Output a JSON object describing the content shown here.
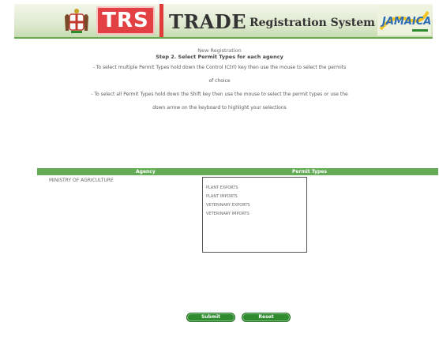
{
  "header": {
    "trs_logo_text": "TRS",
    "title_main": "TRADE",
    "title_sub": "Registration System",
    "jamaica_logo_text": "JAMAICA",
    "colors": {
      "brand_red": "#e34044",
      "brand_green": "#63ab55"
    }
  },
  "instructions": {
    "heading": "New Registration",
    "step": "Step 2. Select Permit Types for each agency",
    "line1": "- To select multiple Permit Types hold down the Control (Ctrl) key then use the mouse to select the permits",
    "line1_cont": "of choice",
    "line2": "- To select all Permit Types hold down the Shift key then use the mouse to select the permit types or use the",
    "line2_cont": "down arrow on the keyboard to highlight your selections"
  },
  "table": {
    "columns": {
      "agency": "Agency",
      "permit_types": "Permit Types"
    },
    "rows": [
      {
        "agency": "MINISTRY OF AGRICULTURE",
        "permit_options": [
          "PLANT EXPORTS",
          "PLANT IMPORTS",
          "VETERINARY EXPORTS",
          "VETERINARY IMPORTS"
        ]
      }
    ]
  },
  "buttons": {
    "submit": "Submit",
    "reset": "Reset"
  }
}
